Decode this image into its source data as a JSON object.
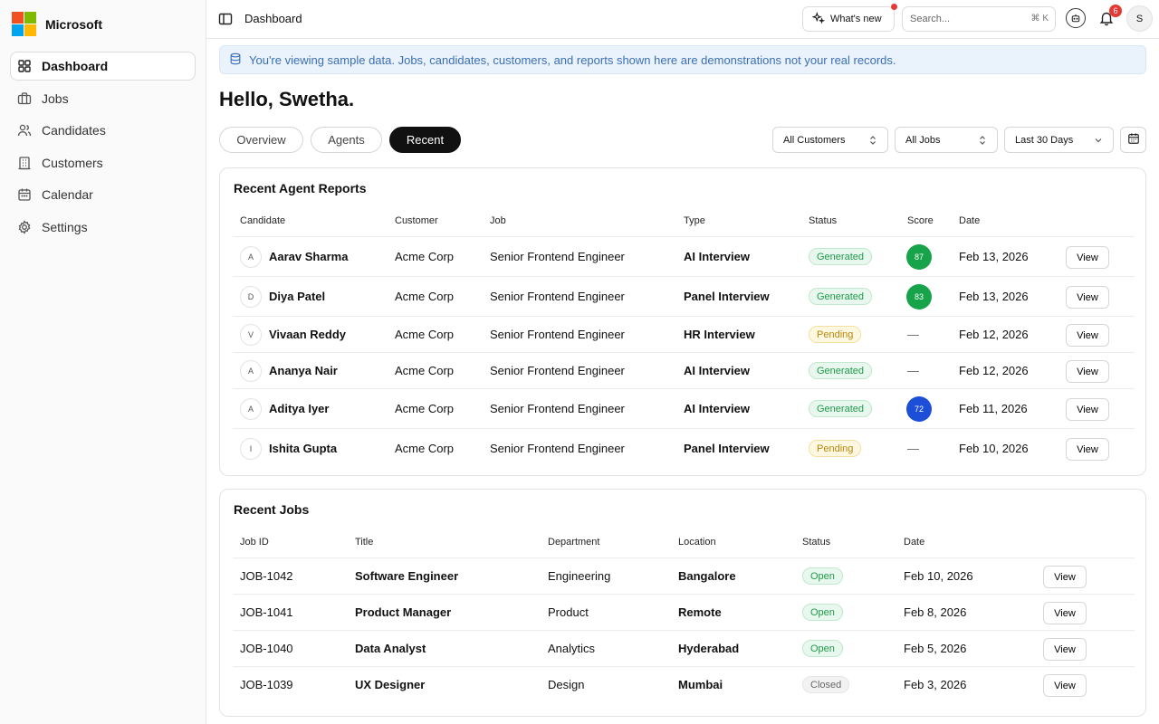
{
  "brand": {
    "name": "Microsoft",
    "logo_colors": [
      "#f25022",
      "#7fba00",
      "#00a4ef",
      "#ffb900"
    ]
  },
  "sidebar": {
    "items": [
      {
        "label": "Dashboard",
        "icon": "dashboard-icon",
        "active": true
      },
      {
        "label": "Jobs",
        "icon": "briefcase-icon"
      },
      {
        "label": "Candidates",
        "icon": "users-icon"
      },
      {
        "label": "Customers",
        "icon": "building-icon"
      },
      {
        "label": "Calendar",
        "icon": "calendar-icon"
      },
      {
        "label": "Settings",
        "icon": "gear-icon"
      }
    ]
  },
  "topbar": {
    "breadcrumb": "Dashboard",
    "whats_new": "What's new",
    "search_placeholder": "Search...",
    "search_shortcut": "⌘ K",
    "notification_count": "6",
    "avatar_initial": "S"
  },
  "banner": "You're viewing sample data. Jobs, candidates, customers, and reports shown here are demonstrations not your real records.",
  "greeting": "Hello, Swetha.",
  "tabs": [
    {
      "label": "Overview"
    },
    {
      "label": "Agents"
    },
    {
      "label": "Recent",
      "active": true
    }
  ],
  "filters": {
    "customer": "All Customers",
    "job": "All Jobs",
    "range": "Last 30 Days"
  },
  "reports": {
    "title": "Recent Agent Reports",
    "headers": {
      "candidate": "Candidate",
      "customer": "Customer",
      "job": "Job",
      "type": "Type",
      "status": "Status",
      "score": "Score",
      "date": "Date"
    },
    "rows": [
      {
        "initial": "A",
        "name": "Aarav Sharma",
        "customer": "Acme Corp",
        "job": "Senior Frontend Engineer",
        "type": "AI Interview",
        "status": "Generated",
        "score": "87",
        "score_color": "#16a34a",
        "date": "Feb 13, 2026",
        "action": "View"
      },
      {
        "initial": "D",
        "name": "Diya Patel",
        "customer": "Acme Corp",
        "job": "Senior Frontend Engineer",
        "type": "Panel Interview",
        "status": "Generated",
        "score": "83",
        "score_color": "#16a34a",
        "date": "Feb 13, 2026",
        "action": "View"
      },
      {
        "initial": "V",
        "name": "Vivaan Reddy",
        "customer": "Acme Corp",
        "job": "Senior Frontend Engineer",
        "type": "HR Interview",
        "status": "Pending",
        "score": "—",
        "score_color": "",
        "date": "Feb 12, 2026",
        "action": "View"
      },
      {
        "initial": "A",
        "name": "Ananya Nair",
        "customer": "Acme Corp",
        "job": "Senior Frontend Engineer",
        "type": "AI Interview",
        "status": "Generated",
        "score": "—",
        "score_color": "",
        "date": "Feb 12, 2026",
        "action": "View"
      },
      {
        "initial": "A",
        "name": "Aditya Iyer",
        "customer": "Acme Corp",
        "job": "Senior Frontend Engineer",
        "type": "AI Interview",
        "status": "Generated",
        "score": "72",
        "score_color": "#1d4ed8",
        "date": "Feb 11, 2026",
        "action": "View"
      },
      {
        "initial": "I",
        "name": "Ishita Gupta",
        "customer": "Acme Corp",
        "job": "Senior Frontend Engineer",
        "type": "Panel Interview",
        "status": "Pending",
        "score": "—",
        "score_color": "",
        "date": "Feb 10, 2026",
        "action": "View"
      }
    ]
  },
  "jobs": {
    "title": "Recent Jobs",
    "headers": {
      "id": "Job ID",
      "title": "Title",
      "department": "Department",
      "location": "Location",
      "status": "Status",
      "date": "Date"
    },
    "rows": [
      {
        "id": "JOB-1042",
        "title": "Software Engineer",
        "department": "Engineering",
        "location": "Bangalore",
        "status": "Open",
        "date": "Feb 10, 2026",
        "action": "View"
      },
      {
        "id": "JOB-1041",
        "title": "Product Manager",
        "department": "Product",
        "location": "Remote",
        "status": "Open",
        "date": "Feb 8, 2026",
        "action": "View"
      },
      {
        "id": "JOB-1040",
        "title": "Data Analyst",
        "department": "Analytics",
        "location": "Hyderabad",
        "status": "Open",
        "date": "Feb 5, 2026",
        "action": "View"
      },
      {
        "id": "JOB-1039",
        "title": "UX Designer",
        "department": "Design",
        "location": "Mumbai",
        "status": "Closed",
        "date": "Feb 3, 2026",
        "action": "View"
      }
    ]
  }
}
